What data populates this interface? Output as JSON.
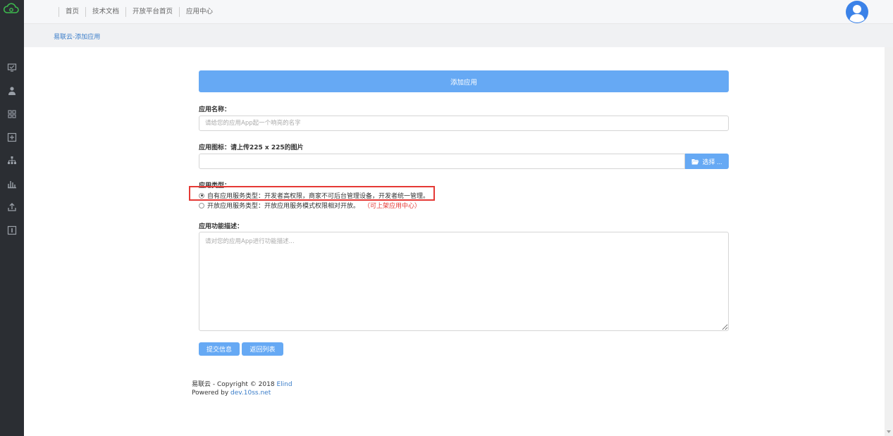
{
  "nav": {
    "items": [
      "首页",
      "技术文档",
      "开放平台首页",
      "应用中心"
    ]
  },
  "breadcrumb": "易联云-添加应用",
  "form": {
    "header": "添加应用",
    "app_name_label": "应用名称：",
    "app_name_placeholder": "请给您的应用App起一个响亮的名字",
    "icon_label": "应用图标：请上传225 x 225的图片",
    "choose_label": "选择 ...",
    "type_label": "应用类型：",
    "type_options": [
      {
        "label": "自有应用服务类型：开发者高权限，商家不可后台管理设备，开发者统一管理。",
        "note": "",
        "checked": true
      },
      {
        "label": "开放应用服务类型：开放应用服务模式权限相对开放。",
        "note": "（可上架应用中心）",
        "checked": false
      }
    ],
    "desc_label": "应用功能描述：",
    "desc_placeholder": "请对您的应用App进行功能描述...",
    "submit_label": "提交信息",
    "back_label": "返回列表"
  },
  "footer": {
    "line1_prefix": "易联云 - Copyright © 2018 ",
    "line1_link": "Elind",
    "line2_prefix": "Powered by ",
    "line2_link": "dev.10ss.net"
  },
  "colors": {
    "sidebar_bg": "#2b2e33",
    "accent": "#66a9f4",
    "highlight": "#e53935",
    "logo_green": "#3db94e"
  },
  "icons": {
    "logo": "cloud-logo-icon",
    "sidebar": [
      "monitor-icon",
      "user-icon",
      "grid-icon",
      "add-box-icon",
      "org-chart-icon",
      "bar-chart-icon",
      "upload-icon",
      "info-box-icon"
    ],
    "avatar": "avatar-icon",
    "choose": "folder-open-icon"
  }
}
